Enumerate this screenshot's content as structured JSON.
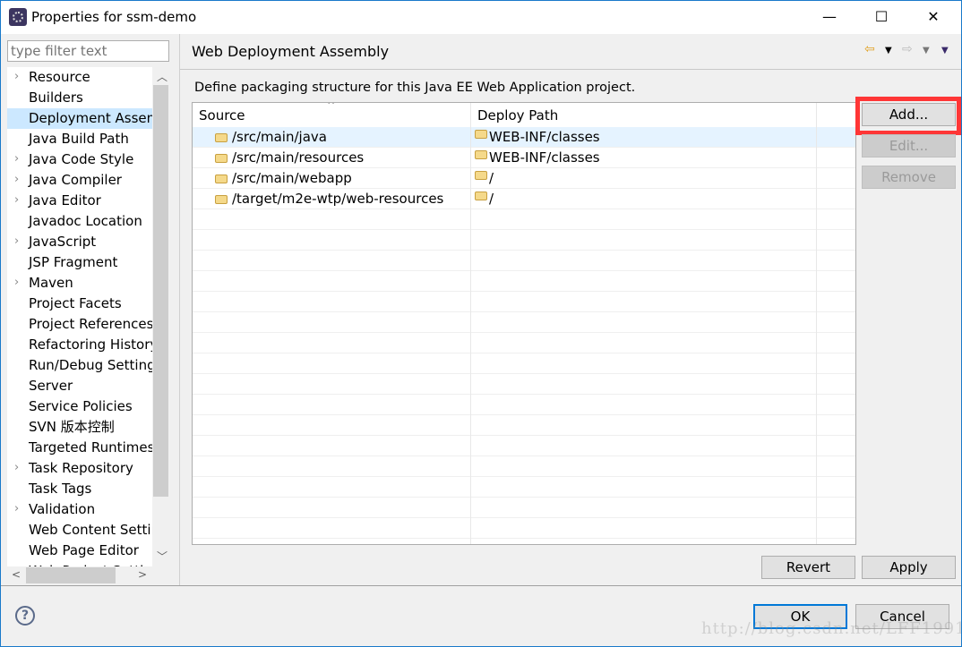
{
  "window": {
    "title": "Properties for ssm-demo",
    "minimize": "—",
    "maximize": "☐",
    "close": "✕"
  },
  "sidebar": {
    "filter_placeholder": "type filter text",
    "items": [
      {
        "label": "Resource",
        "expandable": true
      },
      {
        "label": "Builders",
        "expandable": false
      },
      {
        "label": "Deployment Assembly",
        "expandable": false,
        "selected": true
      },
      {
        "label": "Java Build Path",
        "expandable": false
      },
      {
        "label": "Java Code Style",
        "expandable": true
      },
      {
        "label": "Java Compiler",
        "expandable": true
      },
      {
        "label": "Java Editor",
        "expandable": true
      },
      {
        "label": "Javadoc Location",
        "expandable": false
      },
      {
        "label": "JavaScript",
        "expandable": true
      },
      {
        "label": "JSP Fragment",
        "expandable": false
      },
      {
        "label": "Maven",
        "expandable": true
      },
      {
        "label": "Project Facets",
        "expandable": false
      },
      {
        "label": "Project References",
        "expandable": false
      },
      {
        "label": "Refactoring History",
        "expandable": false
      },
      {
        "label": "Run/Debug Settings",
        "expandable": false
      },
      {
        "label": "Server",
        "expandable": false
      },
      {
        "label": "Service Policies",
        "expandable": false
      },
      {
        "label": "SVN 版本控制",
        "expandable": false
      },
      {
        "label": "Targeted Runtimes",
        "expandable": false
      },
      {
        "label": "Task Repository",
        "expandable": true
      },
      {
        "label": "Task Tags",
        "expandable": false
      },
      {
        "label": "Validation",
        "expandable": true
      },
      {
        "label": "Web Content Settings",
        "expandable": false
      },
      {
        "label": "Web Page Editor",
        "expandable": false
      },
      {
        "label": "Web Project Settings",
        "expandable": false
      }
    ]
  },
  "main": {
    "title": "Web Deployment Assembly",
    "description": "Define packaging structure for this Java EE Web Application project.",
    "columns": [
      "Source",
      "Deploy Path"
    ],
    "rows": [
      {
        "source": "/src/main/java",
        "deploy": "WEB-INF/classes"
      },
      {
        "source": "/src/main/resources",
        "deploy": "WEB-INF/classes"
      },
      {
        "source": "/src/main/webapp",
        "deploy": "/"
      },
      {
        "source": "/target/m2e-wtp/web-resources",
        "deploy": "/"
      }
    ],
    "buttons": {
      "add": "Add...",
      "edit": "Edit...",
      "remove": "Remove",
      "revert": "Revert",
      "apply": "Apply"
    }
  },
  "footer": {
    "ok": "OK",
    "cancel": "Cancel",
    "help": "?"
  },
  "watermark": "http://blog.csdn.net/LFF1991",
  "colors": {
    "highlight": "#ff3636",
    "selection": "#cce8ff",
    "accent": "#0078d7"
  }
}
